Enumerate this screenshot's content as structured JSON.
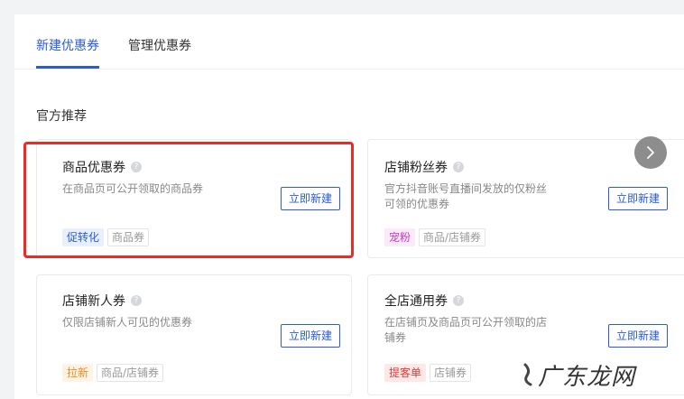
{
  "tabs": [
    {
      "label": "新建优惠券",
      "active": true
    },
    {
      "label": "管理优惠券",
      "active": false
    }
  ],
  "section": {
    "title": "官方推荐"
  },
  "cards": [
    {
      "title": "商品优惠券",
      "desc": "在商品页可公开领取的商品券",
      "button": "立即新建",
      "tags": [
        {
          "text": "促转化",
          "style": "blue"
        },
        {
          "text": "商品券",
          "style": "plain"
        }
      ]
    },
    {
      "title": "店铺粉丝券",
      "desc": "官方抖音账号直播间发放的仅粉丝可领的优惠券",
      "button": "立即新建",
      "tags": [
        {
          "text": "宠粉",
          "style": "pink"
        },
        {
          "text": "商品/店铺券",
          "style": "plain"
        }
      ]
    },
    {
      "title": "店铺新人券",
      "desc": "仅限店铺新人可见的优惠券",
      "button": "立即新建",
      "tags": [
        {
          "text": "拉新",
          "style": "orange"
        },
        {
          "text": "商品/店铺券",
          "style": "plain"
        }
      ]
    },
    {
      "title": "全店通用券",
      "desc": "在店铺页及商品页可公开领取的店铺券",
      "button": "立即新建",
      "tags": [
        {
          "text": "提客单",
          "style": "red"
        },
        {
          "text": "店铺券",
          "style": "plain"
        }
      ]
    }
  ],
  "help_icon": {
    "glyph": "?",
    "name": "question-icon"
  },
  "next_icon": {
    "name": "chevron-right-icon"
  },
  "watermark": {
    "text": "广东龙网"
  },
  "colors": {
    "accent": "#2b5cd6",
    "highlight": "#ee2a24"
  }
}
